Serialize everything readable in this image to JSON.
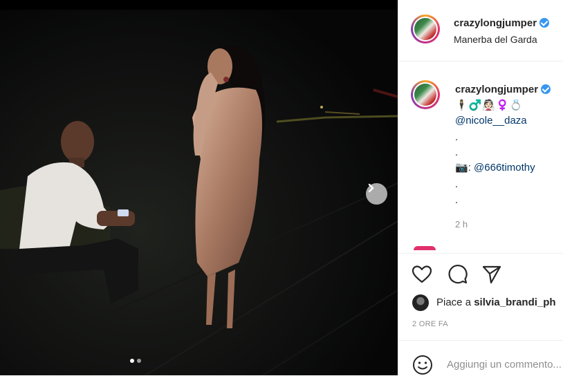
{
  "post": {
    "username": "crazylongjumper",
    "location": "Manerba del Garda"
  },
  "caption": {
    "username": "crazylongjumper",
    "emojis": "🕴️♂️👰🏻♀️💍",
    "mention_1": "@nicole__daza",
    "dot": ".",
    "camera_emoji": "📷",
    "camera_sep": ": ",
    "mention_2": "@666timothy",
    "time": "2 h"
  },
  "likes": {
    "prefix": "Piace a ",
    "user": "silvia_brandi_ph"
  },
  "posted_ago": "2 ORE FA",
  "comment_input": {
    "placeholder": "Aggiungi un commento..."
  },
  "carousel": {
    "count": 2,
    "active_index": 0
  },
  "icons": {
    "like": "heart-icon",
    "comment": "comment-icon",
    "share": "send-icon",
    "next": "chevron-right-icon",
    "emoji": "smiley-icon"
  },
  "colors": {
    "link": "#00376b",
    "verified": "#3897f0",
    "muted": "#8e8e8e"
  }
}
